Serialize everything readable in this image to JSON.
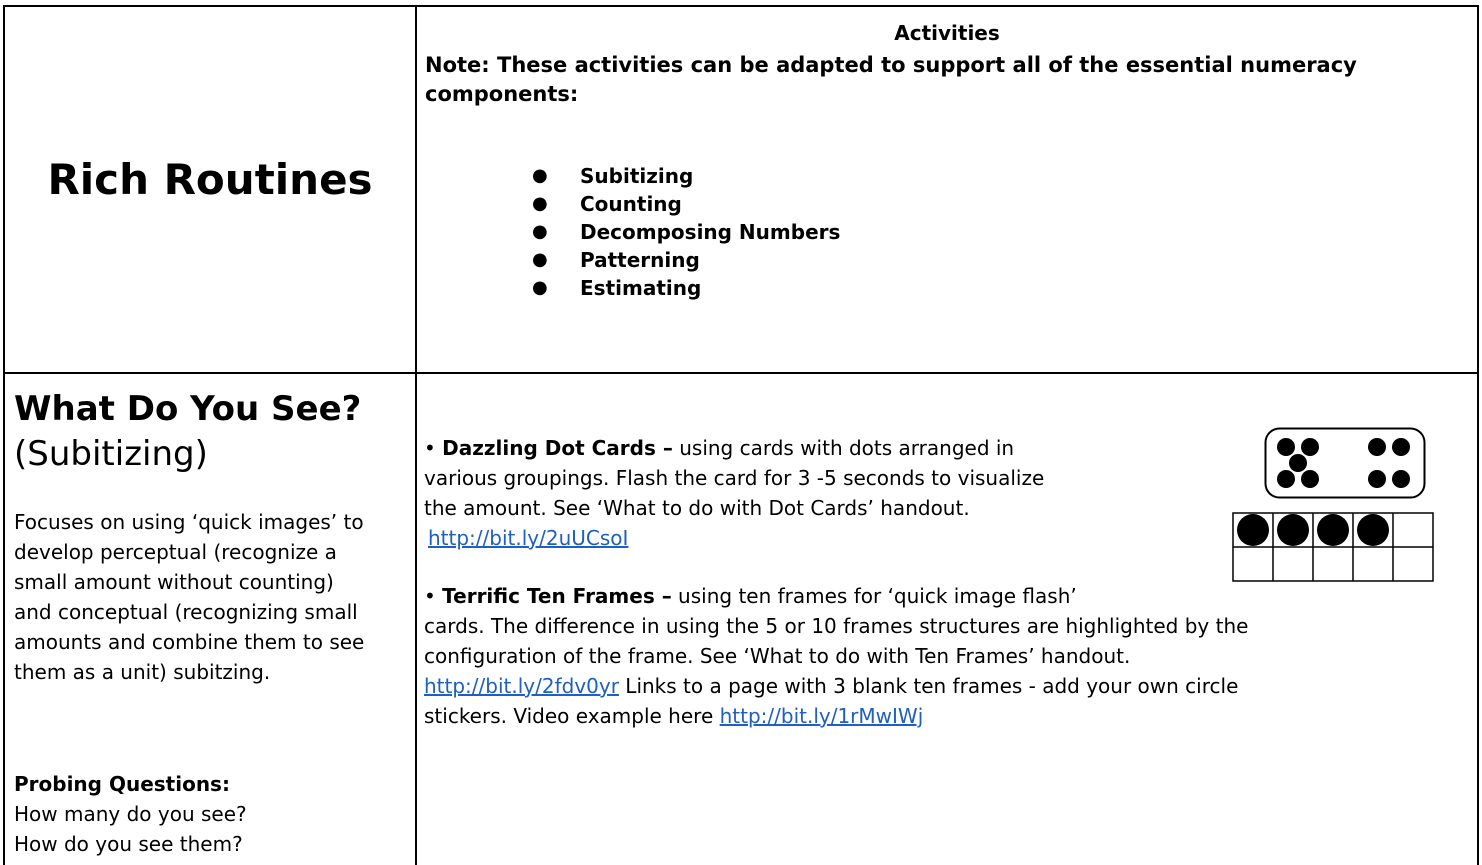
{
  "header": {
    "title": "Rich Routines",
    "activities_heading": "Activities",
    "note_line1": "Note:  These activities can be adapted to support all of the essential numeracy",
    "note_line2": "components:",
    "components": [
      "Subitizing",
      "Counting",
      "Decomposing Numbers",
      "Patterning",
      "Estimating"
    ]
  },
  "routine": {
    "title": "What Do You See?",
    "subtitle": "(Subitizing)",
    "description_lines": [
      "Focuses on using ‘quick images’ to",
      "develop perceptual (recognize a",
      "small amount without counting)",
      "and conceptual (recognizing small",
      "amounts and combine them to see",
      "them as a unit) subitzing."
    ],
    "probing_heading": "Probing Questions:",
    "questions": [
      "How many do you see?",
      "How do you see them?"
    ]
  },
  "activities": {
    "dot_cards": {
      "bullet": "•",
      "name": "Dazzling Dot Cards –",
      "line1_rest": " using cards with dots arranged in",
      "line2": "various groupings.  Flash the card for 3 -5 seconds to visualize",
      "line3": "the amount.  See ‘What to do with Dot Cards’ handout.",
      "link": "http://bit.ly/2uUCsoI"
    },
    "ten_frames": {
      "bullet": "•",
      "name": "Terrific Ten Frames –",
      "line1_rest": " using ten frames for ‘quick image flash’",
      "line2": "cards.  The difference in using the 5 or 10 frames structures are highlighted by the",
      "line3": "configuration of the frame.  See ‘What to do with Ten Frames’ handout.",
      "link1": "http://bit.ly/2fdv0yr",
      "line4_rest": " Links to a page with 3 blank ten frames  - add your own circle",
      "line5_text": "stickers. Video example here ",
      "link2": "http://bit.ly/1rMwIWj"
    },
    "ten_frame_filled": 4
  }
}
